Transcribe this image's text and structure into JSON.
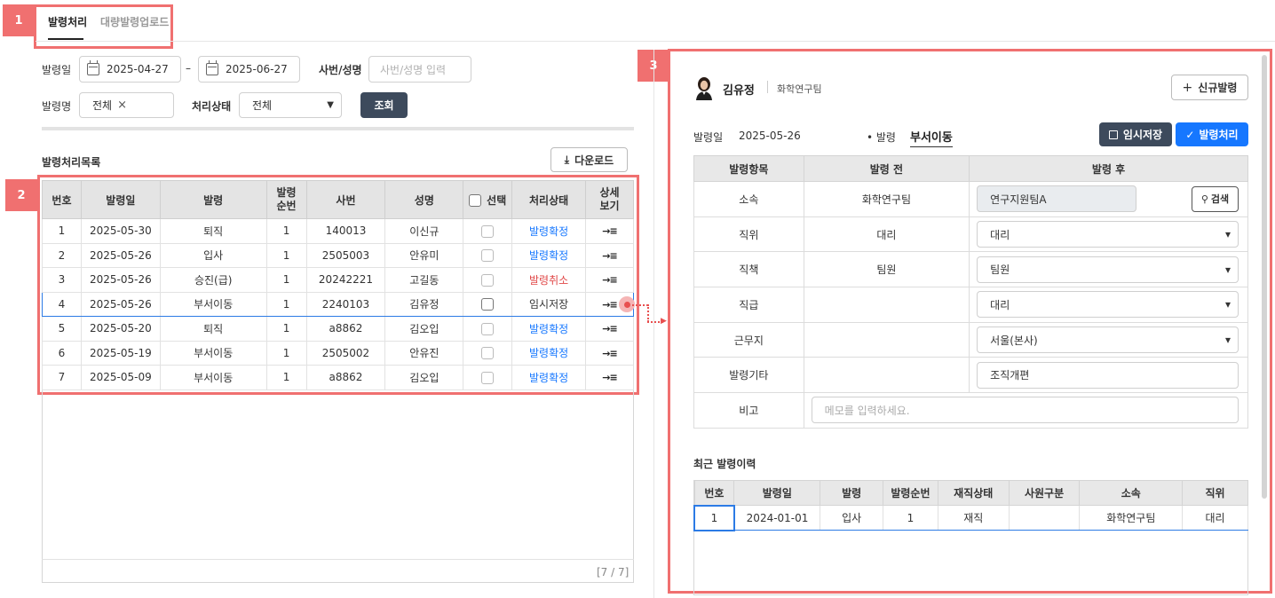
{
  "markers": [
    "1",
    "2",
    "3"
  ],
  "tabs": [
    {
      "label": "발령처리",
      "active": true
    },
    {
      "label": "대량발령업로드",
      "active": false
    }
  ],
  "filters": {
    "date_label": "발령일",
    "date_from": "2025-04-27",
    "date_sep": "–",
    "date_to": "2025-06-27",
    "emp_label": "사번/성명",
    "emp_placeholder": "사번/성명 입력",
    "type_label": "발령명",
    "type_chip": "전체",
    "status_label": "처리상태",
    "status_value": "전체",
    "search_button": "조회"
  },
  "list": {
    "title": "발령처리목록",
    "download_button": "다운로드",
    "columns": [
      "번호",
      "발령일",
      "발령",
      "발령\n순번",
      "사번",
      "성명",
      "선택",
      "처리상태",
      "상세\n보기"
    ],
    "rows": [
      {
        "no": "1",
        "date": "2025-05-30",
        "type": "퇴직",
        "seq": "1",
        "emp_no": "140013",
        "name": "이신규",
        "status": "발령확정",
        "status_color": "#1677ff"
      },
      {
        "no": "2",
        "date": "2025-05-26",
        "type": "입사",
        "seq": "1",
        "emp_no": "2505003",
        "name": "안유미",
        "status": "발령확정",
        "status_color": "#1677ff"
      },
      {
        "no": "3",
        "date": "2025-05-26",
        "type": "승진(급)",
        "seq": "1",
        "emp_no": "20242221",
        "name": "고길동",
        "status": "발령취소",
        "status_color": "#e04848"
      },
      {
        "no": "4",
        "date": "2025-05-26",
        "type": "부서이동",
        "seq": "1",
        "emp_no": "2240103",
        "name": "김유정",
        "status": "임시저장",
        "status_color": "#333333"
      },
      {
        "no": "5",
        "date": "2025-05-20",
        "type": "퇴직",
        "seq": "1",
        "emp_no": "a8862",
        "name": "김오입",
        "status": "발령확정",
        "status_color": "#1677ff"
      },
      {
        "no": "6",
        "date": "2025-05-19",
        "type": "부서이동",
        "seq": "1",
        "emp_no": "2505002",
        "name": "안유진",
        "status": "발령확정",
        "status_color": "#1677ff"
      },
      {
        "no": "7",
        "date": "2025-05-09",
        "type": "부서이동",
        "seq": "1",
        "emp_no": "a8862",
        "name": "김오입",
        "status": "발령확정",
        "status_color": "#1677ff"
      }
    ],
    "selected_row": "4",
    "detail_icon": "→≡",
    "page_count": "[7 / 7]"
  },
  "detail": {
    "employee_name": "김유정",
    "department": "화학연구팀",
    "new_button": "신규발령",
    "date_label": "발령일",
    "date_value": "2025-05-26",
    "order_label": "• 발령",
    "order_value": "부서이동",
    "save_button": "임시저장",
    "process_button": "발령처리",
    "columns": [
      "발령항목",
      "발령 전",
      "발령 후"
    ],
    "rows": [
      {
        "item": "소속",
        "before": "화학연구팀",
        "after": "연구지원팀A",
        "kind": "search"
      },
      {
        "item": "직위",
        "before": "대리",
        "after": "대리",
        "kind": "select"
      },
      {
        "item": "직책",
        "before": "팀원",
        "after": "팀원",
        "kind": "select"
      },
      {
        "item": "직급",
        "before": "",
        "after": "대리",
        "kind": "select"
      },
      {
        "item": "근무지",
        "before": "",
        "after": "서울(본사)",
        "kind": "select"
      },
      {
        "item": "발령기타",
        "before": "",
        "after": "조직개편",
        "kind": "input"
      }
    ],
    "search_button": "검색",
    "memo_label": "비고",
    "memo_placeholder": "메모를 입력하세요.",
    "history_title": "최근 발령이력",
    "history_columns": [
      "번호",
      "발령일",
      "발령",
      "발령순번",
      "재직상태",
      "사원구분",
      "소속",
      "직위"
    ],
    "history_rows": [
      {
        "no": "1",
        "date": "2024-01-01",
        "type": "입사",
        "seq": "1",
        "status": "재직",
        "emp_type": "",
        "dept": "화학연구팀",
        "position": "대리"
      }
    ]
  },
  "colors": {
    "accent": "#1677ff",
    "dark_button": "#3d4a5c",
    "annotation": "#f07070"
  }
}
